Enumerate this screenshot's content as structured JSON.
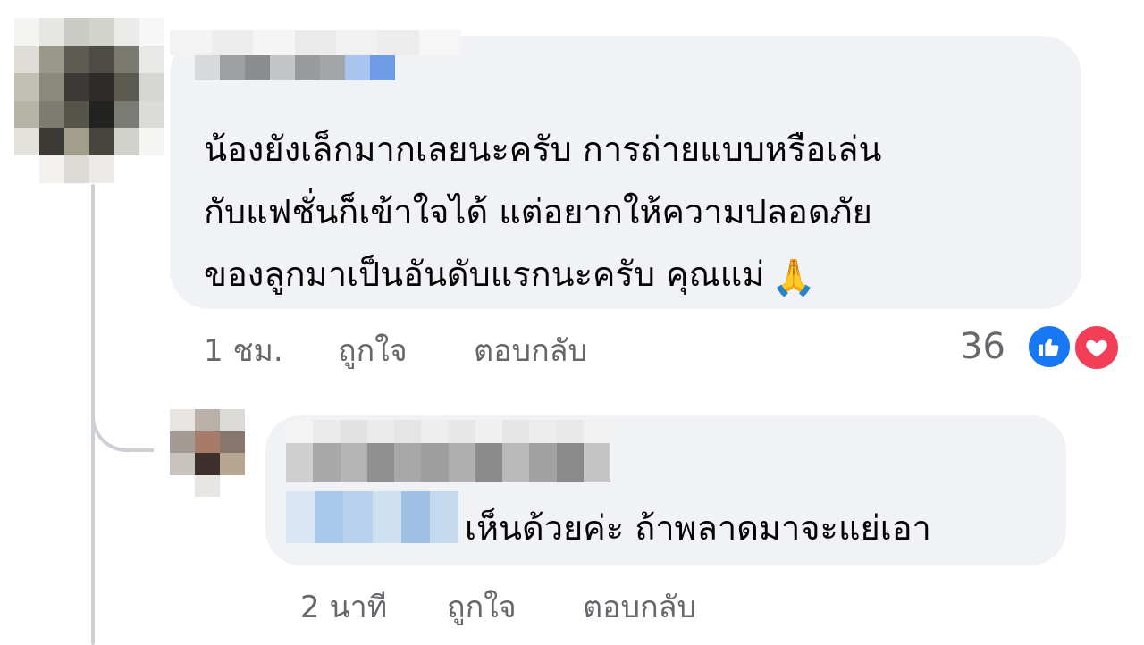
{
  "comments": [
    {
      "text_lines": [
        "น้องยังเล็กมากเลยนะครับ การถ่ายแบบหรือเล่น",
        "กับแฟชั่นก็เข้าใจได้ แต่อยากให้ความปลอดภัย",
        "ของลูกมาเป็นอันดับแรกนะครับ คุณแม่"
      ],
      "emoji": "🙏",
      "time": "1 ชม.",
      "like_label": "ถูกใจ",
      "reply_label": "ตอบกลับ",
      "reaction_count": "36",
      "reactions": [
        "like-icon",
        "love-icon"
      ]
    },
    {
      "text": "เห็นด้วยค่ะ ถ้าพลาดมาจะแย่เอา",
      "time": "2 นาที",
      "like_label": "ถูกใจ",
      "reply_label": "ตอบกลับ"
    }
  ],
  "colors": {
    "bubble": "#f0f2f5",
    "meta_text": "#65676b",
    "like_blue": "#1877f2",
    "love_red": "#f33e58",
    "thread_line": "#ccd0d5"
  }
}
